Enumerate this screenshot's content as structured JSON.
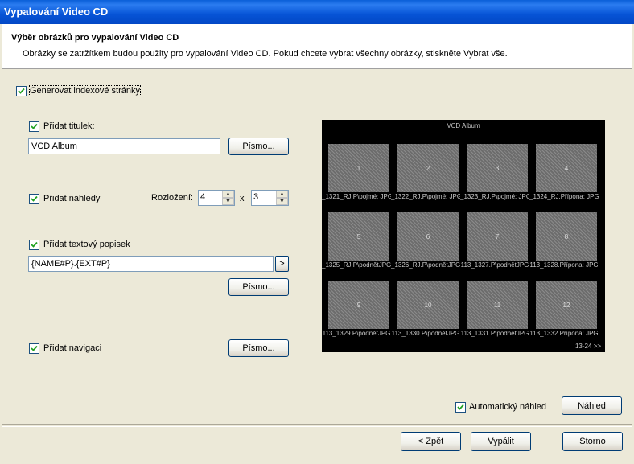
{
  "window": {
    "title": "Vypalování Video CD"
  },
  "header": {
    "title": "Výběr obrázků pro vypalování Video CD",
    "subtitle": "Obrázky se zatržítkem budou použity pro vypalování Video CD. Pokud chcete vybrat všechny obrázky, stiskněte Vybrat vše."
  },
  "options": {
    "generate_index": {
      "label": "Generovat indexové stránky",
      "checked": true
    },
    "add_title": {
      "label": "Přidat titulek:",
      "checked": true,
      "value": "VCD Album",
      "font_button": "Písmo..."
    },
    "add_thumbnails": {
      "label": "Přidat náhledy",
      "checked": true,
      "layout_label": "Rozložení:",
      "cols": "4",
      "times": "x",
      "rows": "3"
    },
    "add_caption": {
      "label": "Přidat textový popisek",
      "checked": true,
      "value": "{NAME#P}.{EXT#P}",
      "arrow": ">",
      "font_button": "Písmo..."
    },
    "add_navigation": {
      "label": "Přidat navigaci",
      "checked": true,
      "font_button": "Písmo..."
    }
  },
  "preview": {
    "title": "VCD Album",
    "nav": "13-24 >>",
    "thumbs": [
      {
        "num": "1",
        "caption": "_1321_RJ.P\\pojmé: JPG"
      },
      {
        "num": "2",
        "caption": "_1322_RJ.P\\pojmé: JPG"
      },
      {
        "num": "3",
        "caption": "_1323_RJ.P\\pojmé: JPG"
      },
      {
        "num": "4",
        "caption": "_1324_RJ.Přípona: JPG"
      },
      {
        "num": "5",
        "caption": "_1325_RJ.P\\podnětJPG"
      },
      {
        "num": "6",
        "caption": "_1326_RJ.P\\podnětJPG"
      },
      {
        "num": "7",
        "caption": "113_1327.P\\podnětJPG"
      },
      {
        "num": "8",
        "caption": "113_1328.Přípona: JPG"
      },
      {
        "num": "9",
        "caption": "113_1329.P\\podnětJPG"
      },
      {
        "num": "10",
        "caption": "113_1330.P\\podnětJPG"
      },
      {
        "num": "11",
        "caption": "113_1331.P\\podnětJPG"
      },
      {
        "num": "12",
        "caption": "113_1332.Přípona: JPG"
      }
    ]
  },
  "auto_preview": {
    "label": "Automatický náhled",
    "checked": true
  },
  "buttons": {
    "preview": "Náhled",
    "back": "< Zpět",
    "burn": "Vypálit",
    "cancel": "Storno"
  }
}
